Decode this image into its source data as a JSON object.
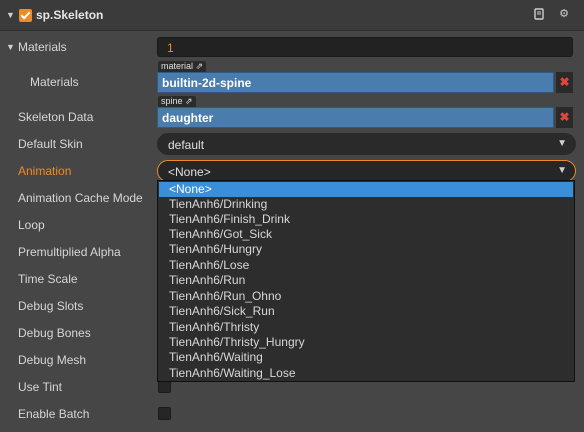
{
  "component": {
    "title": "sp.Skeleton",
    "enabled": true,
    "icons": [
      "book-icon",
      "gear-icon"
    ]
  },
  "properties": {
    "materials_label": "Materials",
    "materials_count": "1",
    "material_item_label": "Materials",
    "material_tag": "material",
    "material_value": "builtin-2d-spine",
    "skeleton_label": "Skeleton Data",
    "skeleton_tag": "spine",
    "skeleton_value": "daughter",
    "default_skin_label": "Default Skin",
    "default_skin_value": "default",
    "animation_label": "Animation",
    "animation_value": "<None>",
    "cache_mode_label": "Animation Cache Mode",
    "loop_label": "Loop",
    "premult_label": "Premultiplied Alpha",
    "time_scale_label": "Time Scale",
    "debug_slots_label": "Debug Slots",
    "debug_bones_label": "Debug Bones",
    "debug_mesh_label": "Debug Mesh",
    "use_tint_label": "Use Tint",
    "enable_batch_label": "Enable Batch"
  },
  "animation_options": [
    "<None>",
    "TienAnh6/Drinking",
    "TienAnh6/Finish_Drink",
    "TienAnh6/Got_Sick",
    "TienAnh6/Hungry",
    "TienAnh6/Lose",
    "TienAnh6/Run",
    "TienAnh6/Run_Ohno",
    "TienAnh6/Sick_Run",
    "TienAnh6/Thristy",
    "TienAnh6/Thristy_Hungry",
    "TienAnh6/Waiting",
    "TienAnh6/Waiting_Lose"
  ],
  "selected_option": "<None>",
  "colors": {
    "accent": "#f08a24",
    "selection": "#3b8fd9",
    "asset": "#4a7dad",
    "remove": "#e0463c"
  }
}
